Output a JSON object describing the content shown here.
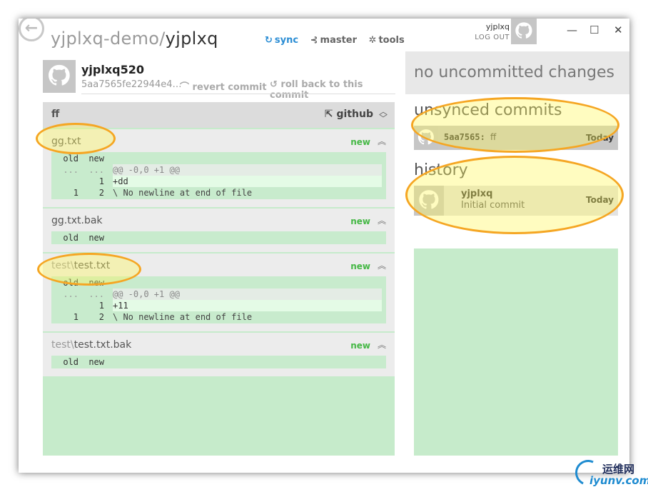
{
  "repo": {
    "owner": "yjplxq-demo",
    "separator": "/",
    "name": "yjplxq"
  },
  "toolbar": {
    "sync": "sync",
    "branch": "master",
    "tools": "tools"
  },
  "account": {
    "username": "yjplxq",
    "logout": "LOG OUT"
  },
  "window_controls": {
    "minimize": "—",
    "maximize": "☐",
    "close": "✕"
  },
  "commit": {
    "author": "yjplxq520",
    "sha": "5aa7565fe22944e4…",
    "revert": "revert commit",
    "rollback": "roll back to this commit",
    "message": "ff",
    "github": "github"
  },
  "files": [
    {
      "dir": "",
      "name": "gg.txt",
      "status": "new",
      "header": {
        "old": "old",
        "new": "new"
      },
      "lines": [
        {
          "old": "...",
          "new": "...",
          "text": "@@ -0,0 +1 @@",
          "kind": "meta"
        },
        {
          "old": "",
          "new": "1",
          "text": "+dd",
          "kind": "add"
        },
        {
          "old": "1",
          "new": "2",
          "text": "\\ No newline at end of file",
          "kind": "nonl"
        }
      ]
    },
    {
      "dir": "",
      "name": "gg.txt.bak",
      "status": "new",
      "header": {
        "old": "old",
        "new": "new"
      },
      "lines": []
    },
    {
      "dir": "test\\",
      "name": "test.txt",
      "status": "new",
      "header": {
        "old": "old",
        "new": "new"
      },
      "lines": [
        {
          "old": "...",
          "new": "...",
          "text": "@@ -0,0 +1 @@",
          "kind": "meta"
        },
        {
          "old": "",
          "new": "1",
          "text": "+11",
          "kind": "add"
        },
        {
          "old": "1",
          "new": "2",
          "text": "\\ No newline at end of file",
          "kind": "nonl"
        }
      ]
    },
    {
      "dir": "test\\",
      "name": "test.txt.bak",
      "status": "new",
      "header": {
        "old": "old",
        "new": "new"
      },
      "lines": []
    }
  ],
  "right": {
    "no_changes": "no uncommitted changes",
    "unsynced_title": "unsynced commits",
    "unsynced": [
      {
        "sha": "5aa7565:",
        "message": "ff",
        "when": "Today"
      }
    ],
    "history_title": "history",
    "history": [
      {
        "author": "yjplxq",
        "message": "Initial commit",
        "when": "Today"
      }
    ]
  },
  "watermark": {
    "cn": "运维网",
    "url": "iyunv.com"
  },
  "colors": {
    "accent": "#2b8dd4",
    "new": "#46b846",
    "diff_bg": "#c6ebcb",
    "highlight": "#f5a623"
  }
}
